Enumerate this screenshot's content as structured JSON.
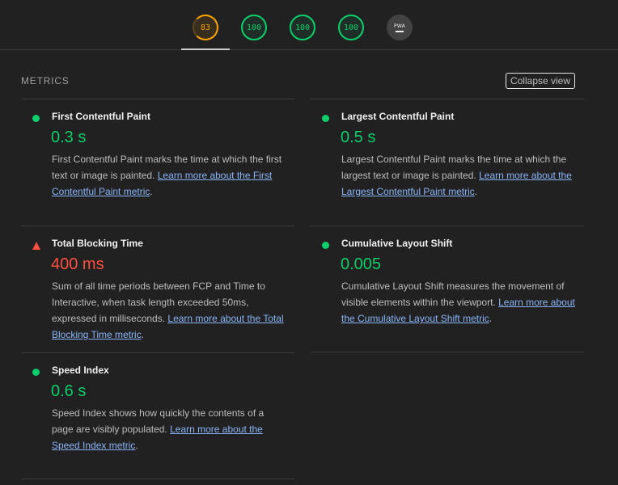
{
  "scores": [
    {
      "value": "83",
      "status": "orange"
    },
    {
      "value": "100",
      "status": "green"
    },
    {
      "value": "100",
      "status": "green"
    },
    {
      "value": "100",
      "status": "green"
    },
    {
      "value": "PWA",
      "status": "na"
    }
  ],
  "colors": {
    "pass": "#0cce6b",
    "average": "#ffa400",
    "fail": "#ff4e42",
    "link": "#8ab4f8",
    "background": "#212121"
  },
  "metrics_section": {
    "title": "METRICS",
    "collapse_label": "Collapse view"
  },
  "metrics": [
    {
      "title": "First Contentful Paint",
      "value": "0.3 s",
      "status": "pass",
      "icon": "green-circle-icon",
      "description": "First Contentful Paint marks the time at which the first text or image is painted.",
      "link": "Learn more about the First Contentful Paint metric"
    },
    {
      "title": "Largest Contentful Paint",
      "value": "0.5 s",
      "status": "pass",
      "icon": "green-circle-icon",
      "description": "Largest Contentful Paint marks the time at which the largest text or image is painted.",
      "link": "Learn more about the Largest Contentful Paint metric"
    },
    {
      "title": "Total Blocking Time",
      "value": "400 ms",
      "status": "fail",
      "icon": "red-triangle-icon",
      "description": "Sum of all time periods between FCP and Time to Interactive, when task length exceeded 50ms, expressed in milliseconds.",
      "link": "Learn more about the Total Blocking Time metric"
    },
    {
      "title": "Cumulative Layout Shift",
      "value": "0.005",
      "status": "pass",
      "icon": "green-circle-icon",
      "description": "Cumulative Layout Shift measures the movement of visible elements within the viewport.",
      "link": "Learn more about the Cumulative Layout Shift metric"
    },
    {
      "title": "Speed Index",
      "value": "0.6 s",
      "status": "pass",
      "icon": "green-circle-icon",
      "description": "Speed Index shows how quickly the contents of a page are visibly populated.",
      "link": "Learn more about the Speed Index metric"
    }
  ]
}
